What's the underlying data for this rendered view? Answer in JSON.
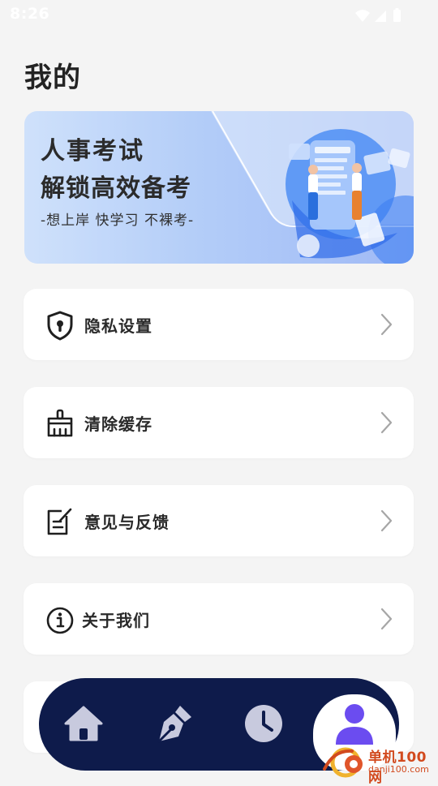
{
  "status_bar": {
    "time": "8:26"
  },
  "page": {
    "title": "我的"
  },
  "banner": {
    "title": "人事考试",
    "subtitle": "解锁高效备考",
    "slogan": "-想上岸 快学习 不裸考-"
  },
  "menu": {
    "items": [
      {
        "label": "隐私设置",
        "icon": "shield-lock-icon"
      },
      {
        "label": "清除缓存",
        "icon": "broom-icon"
      },
      {
        "label": "意见与反馈",
        "icon": "edit-note-icon"
      },
      {
        "label": "关于我们",
        "icon": "info-icon"
      }
    ]
  },
  "tab_bar": {
    "tabs": [
      {
        "icon": "home-icon",
        "active": false
      },
      {
        "icon": "pen-nib-icon",
        "active": false
      },
      {
        "icon": "clock-icon",
        "active": false
      },
      {
        "icon": "user-icon",
        "active": true
      }
    ]
  },
  "watermark": {
    "name": "单机100网",
    "url": "danji100.com"
  },
  "colors": {
    "background": "#f4f4f4",
    "card": "#ffffff",
    "tab_bar": "#0e1b4b",
    "tab_icon_inactive": "#c8cade",
    "tab_icon_active": "#6b4cf0",
    "chevron": "#a6a6a6"
  }
}
